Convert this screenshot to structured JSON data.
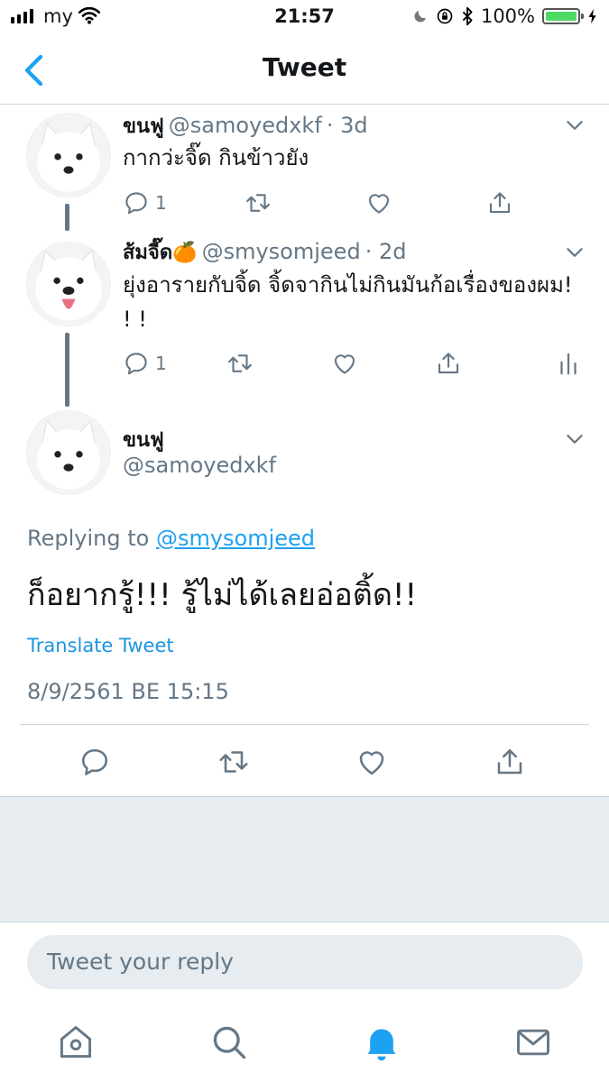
{
  "status_bar": {
    "carrier": "my",
    "time": "21:57",
    "battery": "100%",
    "battery_level": 1.0
  },
  "nav": {
    "title": "Tweet",
    "back_icon": "chevron-left-icon"
  },
  "thread": [
    {
      "name": "ขนฟู",
      "handle": "@samoyedxkf",
      "time": "· 3d",
      "text": "กากว่ะจิ๊ด กินข้าวยัง",
      "reply_count": "1"
    },
    {
      "name": "ส้มจี๊ด🍊",
      "handle": "@smysomjeed",
      "time": "· 2d",
      "text": "ยุ่งอารายกับจิ้ด จิ้ดจากินไม่กินมันก้อเรื่องของผม! ! !",
      "reply_count": "1"
    }
  ],
  "main_tweet": {
    "name": "ขนฟู",
    "handle": "@samoyedxkf",
    "replying_prefix": "Replying to",
    "replying_to": "@smysomjeed",
    "text": "ก็อยากรู้!!! รู้ไม่ได้เลยอ่อติ้ด!!",
    "translate": "Translate Tweet",
    "timestamp": "8/9/2561 BE 15:15"
  },
  "reply_box": {
    "placeholder": "Tweet your reply"
  },
  "tabs": [
    "home-icon",
    "search-icon",
    "notifications-bell-icon",
    "messages-envelope-icon"
  ],
  "colors": {
    "accent": "#1da1f2",
    "secondary_text": "#657786",
    "gray_bg": "#e6ecf0",
    "battery": "#4cd964"
  }
}
